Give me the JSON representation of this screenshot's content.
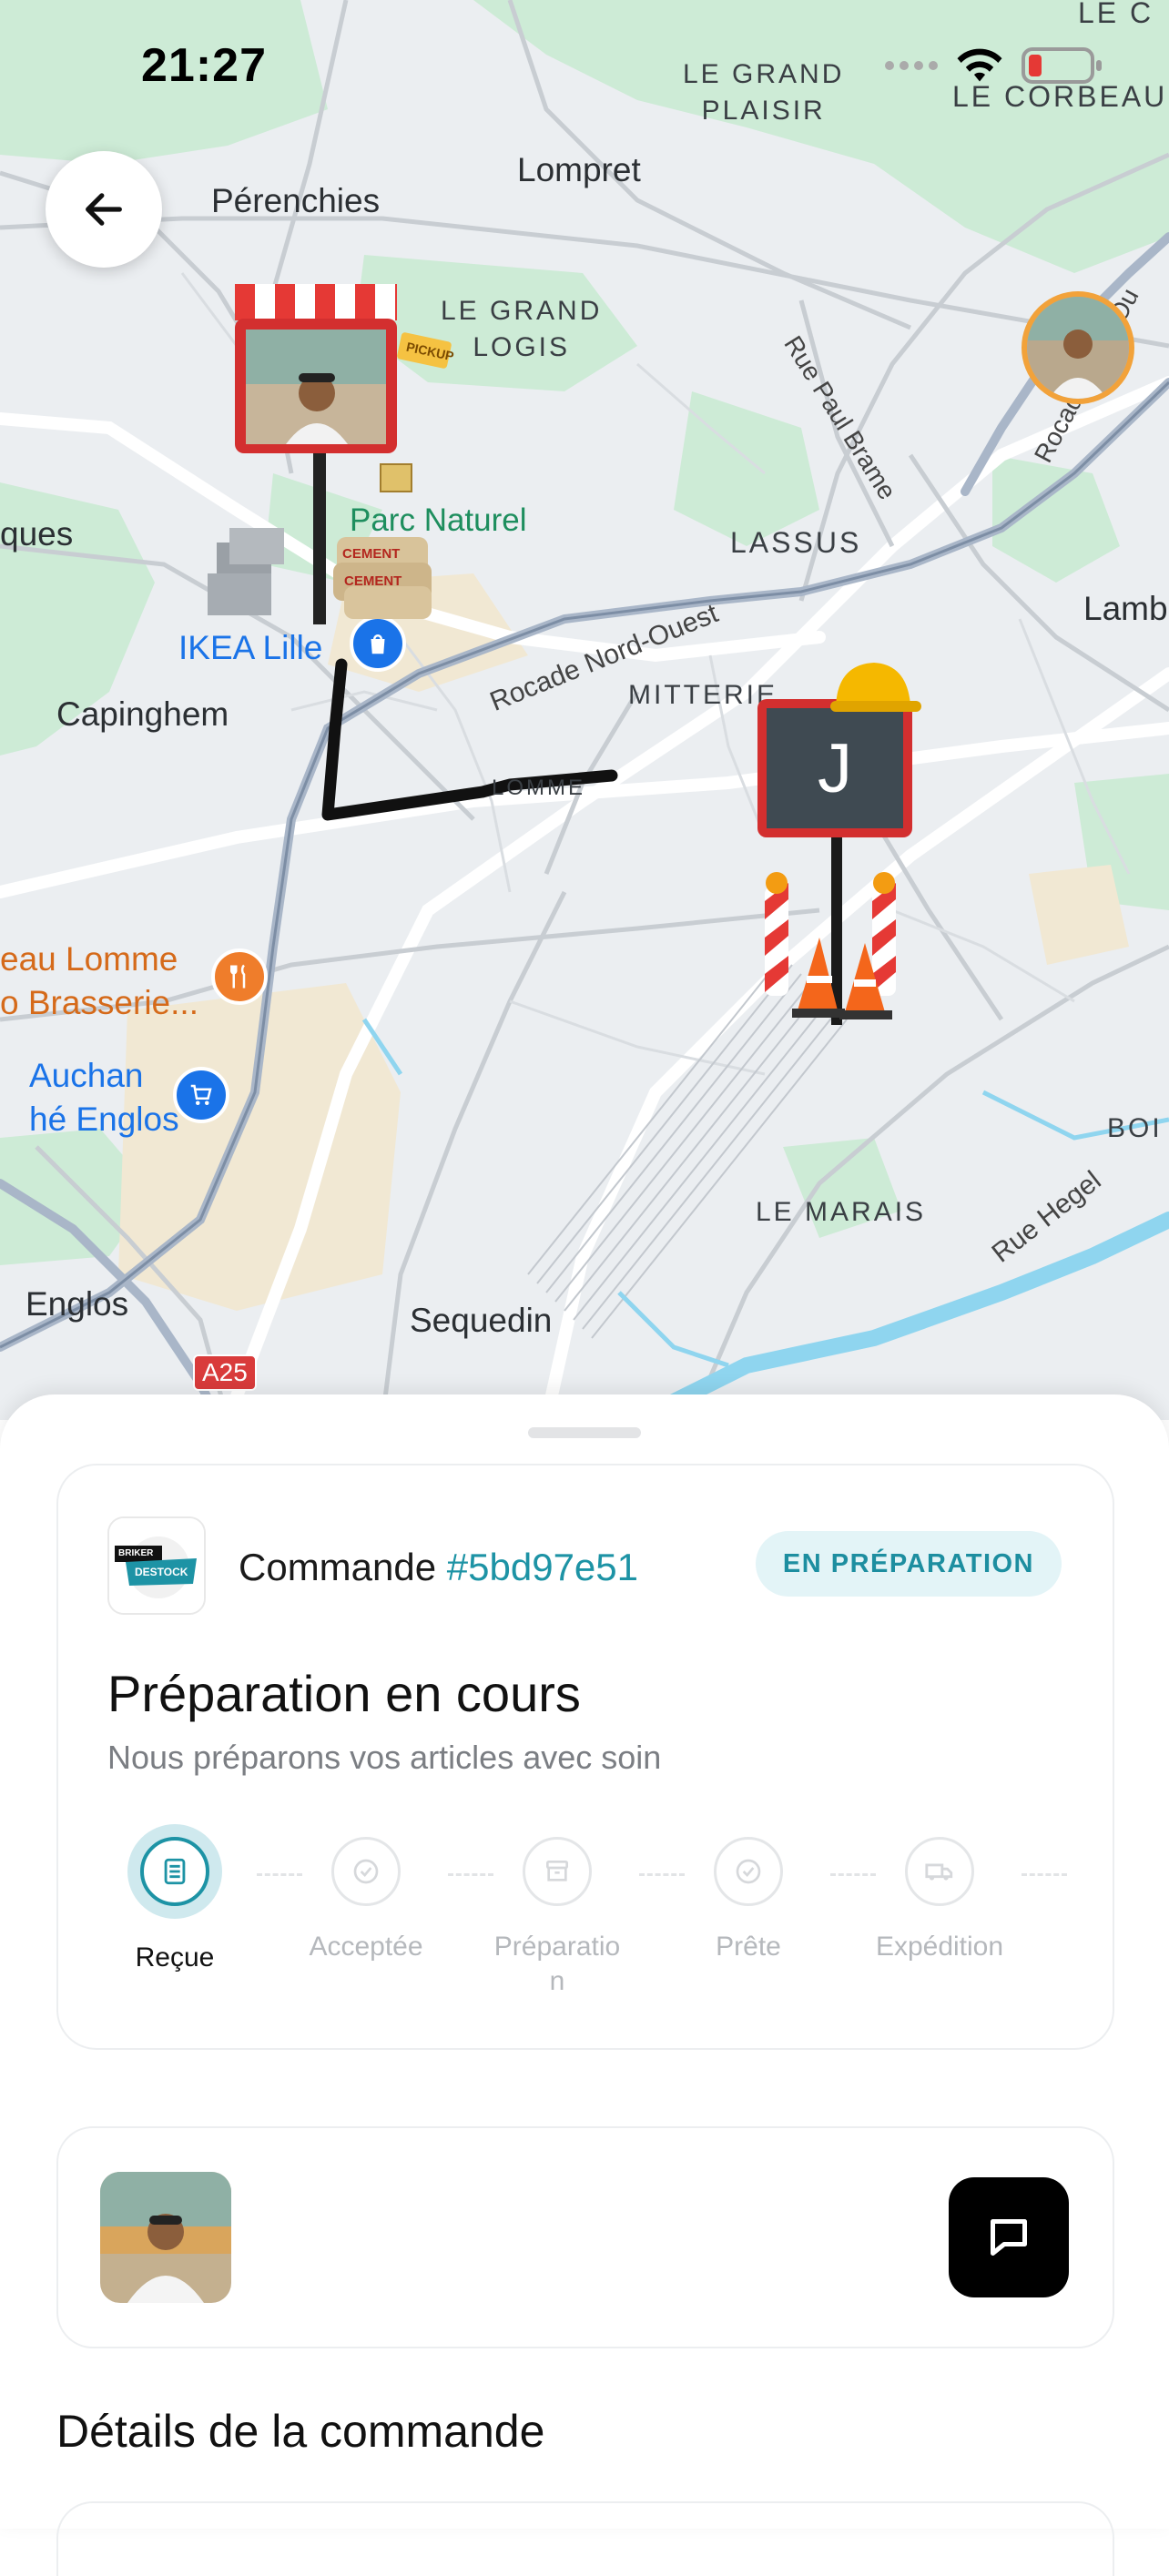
{
  "status_bar": {
    "time": "21:27"
  },
  "map": {
    "places": {
      "le_grand_plaisir": "LE GRAND\nPLAISIR",
      "le_corbeau": "LE CORBEAU",
      "le_c": "LE C",
      "lompret": "Lompret",
      "perenchies": "Pérenchies",
      "le_grand_logis": "LE GRAND\nLOGIS",
      "rue_paul_brame": "Rue Paul Brame",
      "rocade_nord_ouest_2": "Rocade Nord-Ou",
      "parc_naturel": "Parc Naturel\nbain",
      "lassus": "LASSUS",
      "lamb": "Lamb",
      "ques": "ques",
      "rocade_nord_ouest": "Rocade Nord-Ouest",
      "ikea": "IKEA Lille",
      "mitterie": "MITTERIE",
      "capinghem": "Capinghem",
      "lomme": "LOMME",
      "brasserie": "eau Lomme\no Brasserie...",
      "auchan": "Auchan\nhé Englos",
      "boi": "BOI",
      "rue_hegel": "Rue Hegel",
      "le_marais": "LE MARAIS",
      "englos": "Englos",
      "sequedin": "Sequedin",
      "a25": "A25"
    },
    "markers": {
      "store_pickup_tag": "PICKUP",
      "cement_1": "CEMENT",
      "cement_2": "CEMENT",
      "worksite_initial": "J"
    }
  },
  "order": {
    "title_prefix": "Commande",
    "number": "#5bd97e51",
    "status_badge": "EN PRÉPARATION",
    "stage_title": "Préparation en cours",
    "stage_subtitle": "Nous préparons vos articles avec soin",
    "store_logo_line1": "BRIKER",
    "store_logo_line2": "DESTOCK",
    "steps": [
      {
        "label": "Reçue",
        "active": true
      },
      {
        "label": "Acceptée",
        "active": false
      },
      {
        "label": "Préparatio\nn",
        "active": false
      },
      {
        "label": "Prête",
        "active": false
      },
      {
        "label": "Expédition",
        "active": false
      }
    ]
  },
  "details": {
    "title": "Détails de la commande"
  },
  "colors": {
    "accent": "#1d93a5",
    "badge_bg": "#e3f4f7",
    "map_water": "#8fd5ef",
    "map_park": "#c9ead3"
  }
}
